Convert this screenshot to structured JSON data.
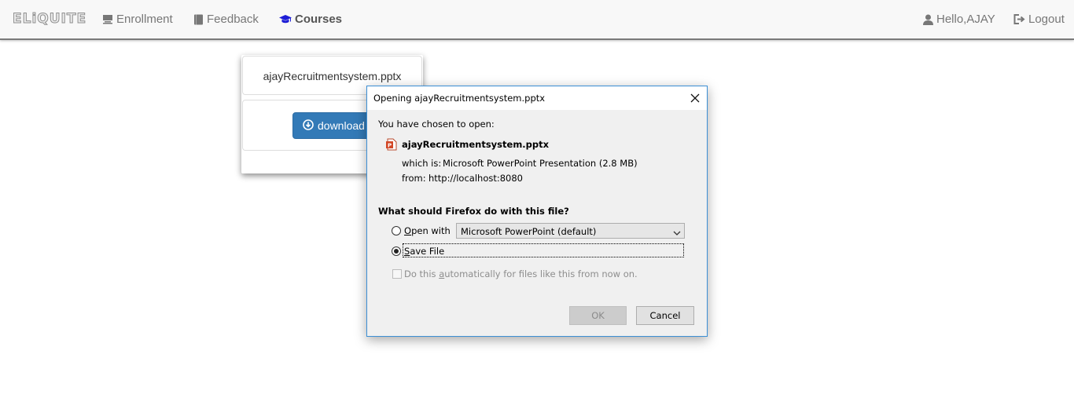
{
  "navbar": {
    "brand": "ELiQUITE",
    "items": [
      {
        "label": "Enrollment",
        "icon": "desktop-icon"
      },
      {
        "label": "Feedback",
        "icon": "book-icon"
      },
      {
        "label": "Courses",
        "icon": "graduation-cap-icon",
        "active": true
      }
    ],
    "user": {
      "label": "Hello,AJAY",
      "icon": "user-icon"
    },
    "logout": {
      "label": "Logout",
      "icon": "logout-icon"
    }
  },
  "card": {
    "filename": "ajayRecruitmentsystem.pptx",
    "download_label": "download",
    "download_icon": "download-circle-icon"
  },
  "dialog": {
    "title": "Opening ajayRecruitmentsystem.pptx",
    "chosen_label": "You have chosen to open:",
    "file_name": "ajayRecruitmentsystem.pptx",
    "which_is_label": "which is:",
    "which_is_value": "Microsoft PowerPoint Presentation (2.8 MB)",
    "from_label": "from:",
    "from_value": "http://localhost:8080",
    "question": "What should Firefox do with this file?",
    "open_with": {
      "accel": "O",
      "rest": "pen with",
      "selected": false
    },
    "open_with_app": "Microsoft PowerPoint (default)",
    "save_file": {
      "accel": "S",
      "rest": "ave File",
      "selected": true
    },
    "auto": {
      "before": "Do this ",
      "accel": "a",
      "after": "utomatically for files like this from now on.",
      "checked": false,
      "disabled": true
    },
    "ok_label": "OK",
    "cancel_label": "Cancel"
  },
  "colors": {
    "primary_button": "#337ab7",
    "dialog_border": "#3c8fd5",
    "nav_icon_active": "#1d1dd6"
  }
}
